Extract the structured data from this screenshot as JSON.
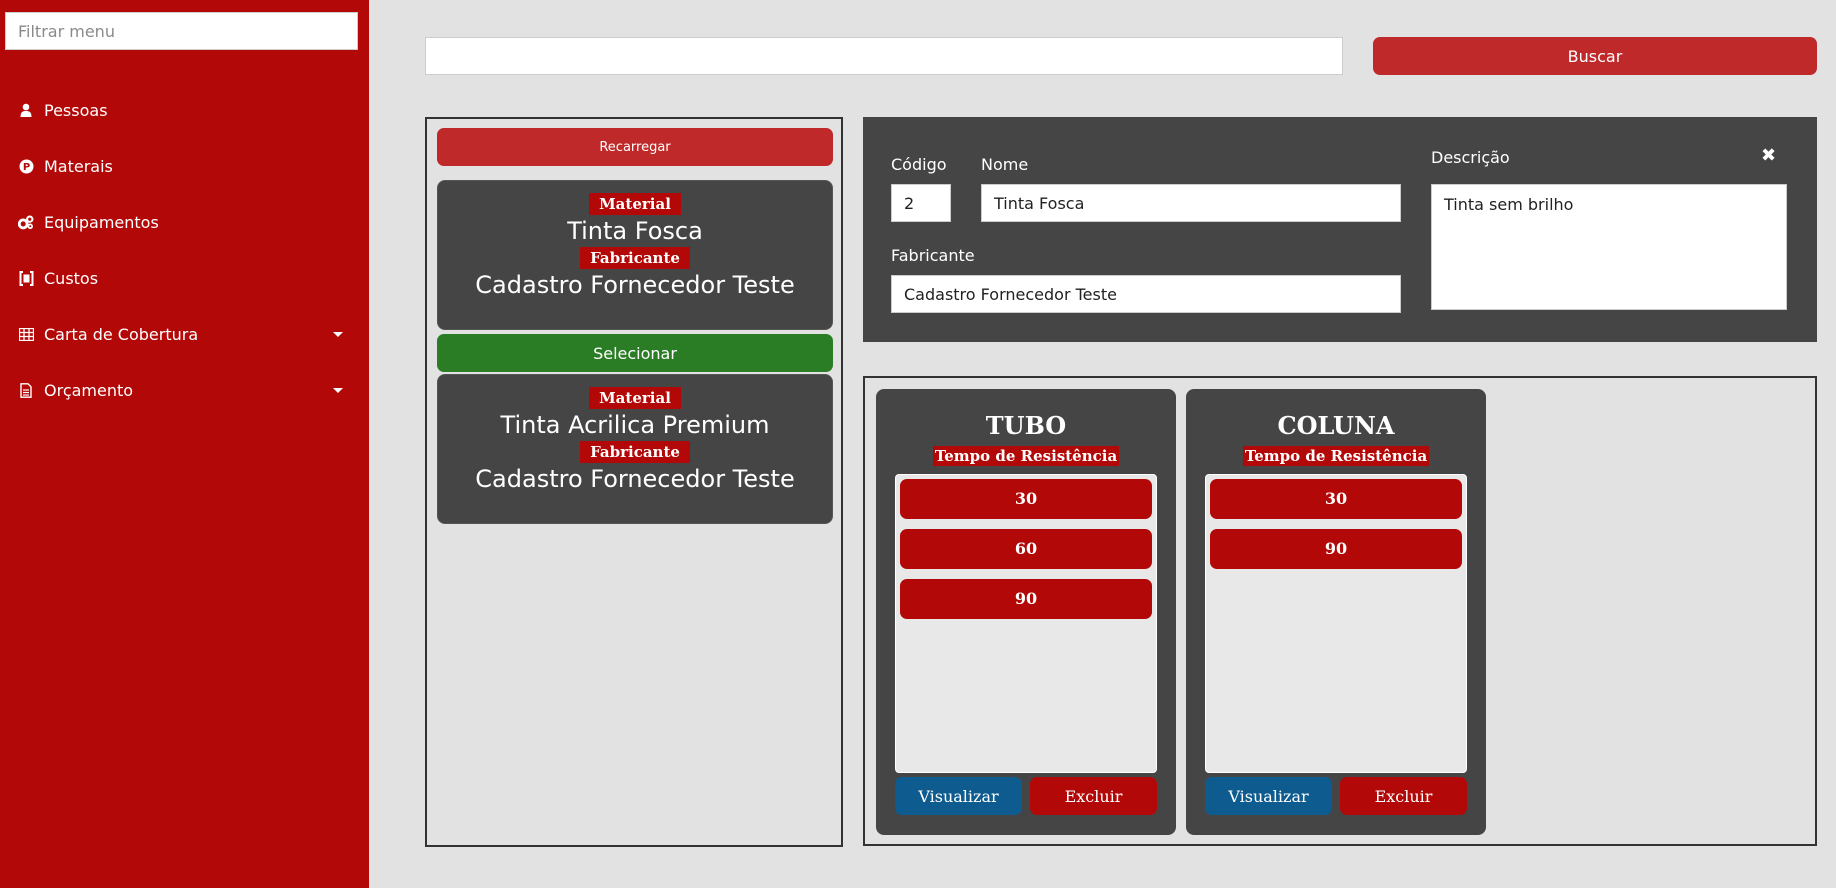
{
  "sidebar": {
    "filter_placeholder": "Filtrar menu",
    "items": [
      {
        "label": "Pessoas",
        "icon": "user-icon",
        "has_caret": false
      },
      {
        "label": "Materais",
        "icon": "parking-circle-icon",
        "has_caret": false
      },
      {
        "label": "Equipamentos",
        "icon": "gears-icon",
        "has_caret": false
      },
      {
        "label": "Custos",
        "icon": "money-bracket-icon",
        "has_caret": false
      },
      {
        "label": "Carta de Cobertura",
        "icon": "table-icon",
        "has_caret": true
      },
      {
        "label": "Orçamento",
        "icon": "document-icon",
        "has_caret": true
      }
    ]
  },
  "search": {
    "value": "",
    "button_label": "Buscar"
  },
  "list": {
    "reload_label": "Recarregar",
    "select_label": "Selecionar",
    "items": [
      {
        "material_tag": "Material",
        "material": "Tinta Fosca",
        "manufacturer_tag": "Fabricante",
        "manufacturer": "Cadastro Fornecedor Teste"
      },
      {
        "material_tag": "Material",
        "material": "Tinta Acrilica Premium",
        "manufacturer_tag": "Fabricante",
        "manufacturer": "Cadastro Fornecedor Teste"
      }
    ]
  },
  "detail": {
    "codigo_label": "Código",
    "codigo_value": "2",
    "nome_label": "Nome",
    "nome_value": "Tinta Fosca",
    "fabricante_label": "Fabricante",
    "fabricante_value": "Cadastro Fornecedor Teste",
    "descricao_label": "Descrição",
    "descricao_value": "Tinta sem brilho",
    "close_symbol": "✖"
  },
  "resistance_cards": [
    {
      "title": "TUBO",
      "subtitle": "Tempo de Resistência",
      "values": [
        "30",
        "60",
        "90"
      ],
      "view_label": "Visualizar",
      "delete_label": "Excluir"
    },
    {
      "title": "COLUNA",
      "subtitle": "Tempo de Resistência",
      "values": [
        "30",
        "90"
      ],
      "view_label": "Visualizar",
      "delete_label": "Excluir"
    }
  ],
  "colors": {
    "sidebar": "#b30808",
    "primary_button": "#bf2929",
    "select_button": "#2a7d25",
    "view_button": "#0e5c8f",
    "panel_dark": "#454545",
    "background": "#e2e2e2"
  }
}
